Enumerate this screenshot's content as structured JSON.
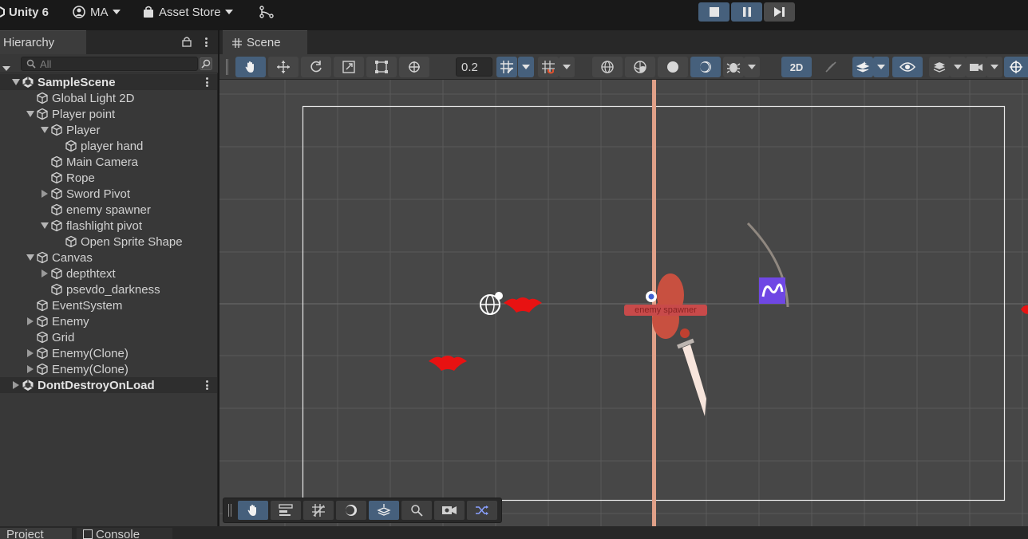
{
  "topbar": {
    "app_title": "Unity 6",
    "account_label": "MA",
    "asset_store_label": "Asset Store"
  },
  "hierarchy": {
    "tab_label": "Hierarchy",
    "search_placeholder": "All",
    "rows": [
      {
        "label": "SampleScene",
        "depth": 0,
        "type": "scene",
        "expanded": true
      },
      {
        "label": "Global Light 2D",
        "depth": 1,
        "type": "object",
        "expanded": null
      },
      {
        "label": "Player point",
        "depth": 1,
        "type": "object",
        "expanded": true
      },
      {
        "label": "Player",
        "depth": 2,
        "type": "object",
        "expanded": true
      },
      {
        "label": "player hand",
        "depth": 3,
        "type": "object",
        "expanded": null
      },
      {
        "label": "Main Camera",
        "depth": 2,
        "type": "object",
        "expanded": null
      },
      {
        "label": "Rope",
        "depth": 2,
        "type": "object",
        "expanded": null
      },
      {
        "label": "Sword Pivot",
        "depth": 2,
        "type": "object",
        "expanded": false
      },
      {
        "label": "enemy spawner",
        "depth": 2,
        "type": "object",
        "expanded": null
      },
      {
        "label": "flashlight pivot",
        "depth": 2,
        "type": "object",
        "expanded": true
      },
      {
        "label": "Open Sprite Shape",
        "depth": 3,
        "type": "object",
        "expanded": null
      },
      {
        "label": "Canvas",
        "depth": 1,
        "type": "object",
        "expanded": true
      },
      {
        "label": "depthtext",
        "depth": 2,
        "type": "object",
        "expanded": false
      },
      {
        "label": "psevdo_darkness",
        "depth": 2,
        "type": "object",
        "expanded": null
      },
      {
        "label": "EventSystem",
        "depth": 1,
        "type": "object",
        "expanded": null
      },
      {
        "label": "Enemy",
        "depth": 1,
        "type": "object",
        "expanded": false
      },
      {
        "label": "Grid",
        "depth": 1,
        "type": "object",
        "expanded": null
      },
      {
        "label": "Enemy(Clone)",
        "depth": 1,
        "type": "object",
        "expanded": false
      },
      {
        "label": "Enemy(Clone)",
        "depth": 1,
        "type": "object",
        "expanded": false
      },
      {
        "label": "DontDestroyOnLoad",
        "depth": 0,
        "type": "scene",
        "expanded": false
      }
    ]
  },
  "scene": {
    "tab_label": "Scene",
    "snap_value": "0.2",
    "mode_2d_label": "2D",
    "spawner_label": "enemy spawner"
  },
  "bottom": {
    "tabs": [
      "Project",
      "Console"
    ]
  },
  "colors": {
    "accent": "#46607c",
    "enemy": "#e81212",
    "spawner": "#c85040"
  }
}
